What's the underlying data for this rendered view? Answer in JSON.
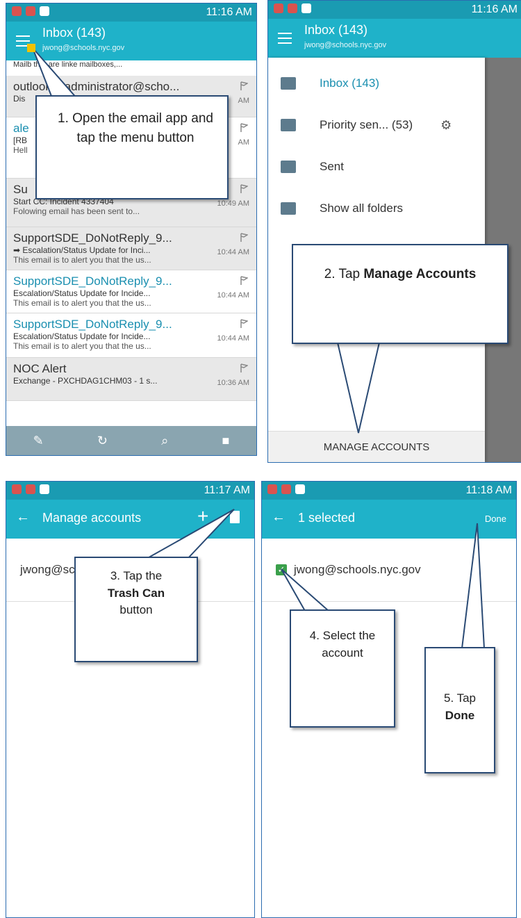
{
  "panel1": {
    "time": "11:16 AM",
    "title": "Inbox (143)",
    "subtitle": "jwong@schools.nyc.gov",
    "top_snippet": "Mailb  that are linke  mailboxes,...",
    "emails": [
      {
        "sender": "outlook... administrator@scho...",
        "subject": "Dis",
        "preview": "",
        "time": "AM",
        "gray": true,
        "unread": false
      },
      {
        "sender": "ale",
        "subject": "[RB",
        "preview": "Hell",
        "time": "AM",
        "gray": false,
        "unread": true
      },
      {
        "sender": "Su",
        "subject": "Start CC: Incident 4337404",
        "preview": "Folowing email has been sent to...",
        "time": "10:49 AM",
        "gray": true,
        "unread": false
      },
      {
        "sender": "SupportSDE_DoNotReply_9...",
        "subject": "➡ Escalation/Status Update for Inci...",
        "preview": "This email is to alert you that the us...",
        "time": "10:44 AM",
        "gray": true,
        "unread": false
      },
      {
        "sender": "SupportSDE_DoNotReply_9...",
        "subject": "Escalation/Status Update for Incide...",
        "preview": "This email is to alert you that the us...",
        "time": "10:44 AM",
        "gray": false,
        "unread": true
      },
      {
        "sender": "SupportSDE_DoNotReply_9...",
        "subject": "Escalation/Status Update for Incide...",
        "preview": "This email is to alert you that the us...",
        "time": "10:44 AM",
        "gray": false,
        "unread": true
      },
      {
        "sender": "NOC Alert",
        "subject": "Exchange - PXCHDAG1CHM03 - 1 s...",
        "preview": "",
        "time": "10:36 AM",
        "gray": true,
        "unread": false
      }
    ],
    "callout": "1.   Open the email app and tap the menu button"
  },
  "panel2": {
    "time": "11:16 AM",
    "title": "Inbox (143)",
    "subtitle": "jwong@schools.nyc.gov",
    "drawer_items": [
      {
        "label": "Inbox (143)",
        "active": true
      },
      {
        "label": "Priority sen...  (53)",
        "active": false
      },
      {
        "label": "Sent",
        "active": false
      },
      {
        "label": "Show all folders",
        "active": false
      }
    ],
    "manage_label": "MANAGE ACCOUNTS",
    "callout_prefix": "2. Tap ",
    "callout_bold": "Manage Accounts"
  },
  "panel3": {
    "time": "11:17 AM",
    "title": "Manage accounts",
    "account": "jwong@schools.nyc.gov",
    "callout_prefix": "3. Tap the",
    "callout_bold": "Trash Can",
    "callout_suffix": "button"
  },
  "panel4": {
    "time": "11:18 AM",
    "title": "1 selected",
    "done_label": "Done",
    "account": "jwong@schools.nyc.gov",
    "callout4": "4. Select the account",
    "callout5_prefix": "5. Tap",
    "callout5_bold": "Done"
  },
  "colors": {
    "accent": "#1fb2c9",
    "statusbar": "#1a9bb2",
    "callout_border": "#2a4a74"
  }
}
